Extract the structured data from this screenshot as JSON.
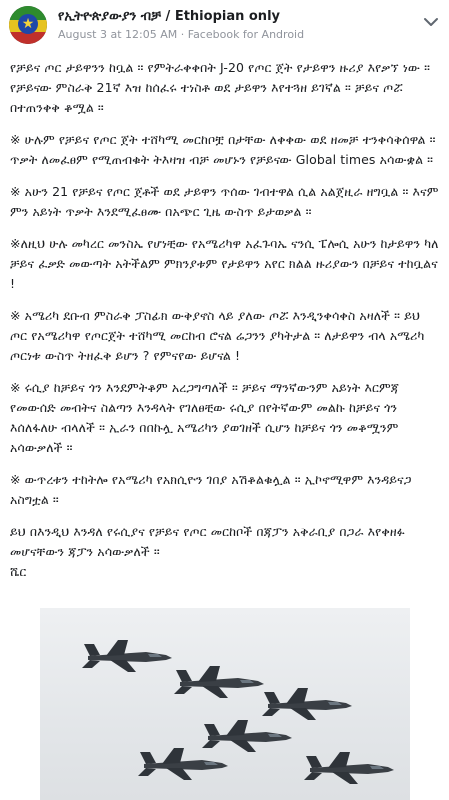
{
  "header": {
    "page_name": "የኢትዮጵያውያን ብቻ / Ethiopian only",
    "date": "August 3 at 12:05 AM",
    "separator": "·",
    "source": "Facebook for Android"
  },
  "post": {
    "paragraphs": [
      "የቻይና ጦር ታይዋንን ከቧል ። የምትራቀቀበት J-20 የጦር ጀት የታይዋን ዙሪያ እየቃኘ ነው ። የቻይናው ምስራቅ 21ኛ እዝ ከሰፈሩ ተነስቶ ወደ ታይዋን እየተጓዘ ይገኛል ። ቻይና ጦሯ በተጠንቀቅ ቆሟል ።",
      "※ ሁሉም የቻይና የጦር ጀት ተሸካሚ መርከቦቿ በታቸው ለቀቀው ወደ ዘመቻ ተንቀሳቅሰዋል ። ጥቃት ለመፈፀም የሚጠብቁት ትእዛዝ ብቻ መሆኑን የቻይናው Global times አሳውቋል ።",
      "※ አሁን 21 የቻይና የጦር ጀቶች ወደ ታይዋን ጥሰው ገብተዋል ሲል አልጀዚራ ዘግቧል ። እናም ምን አይነት ጥቃት እንደሚፈፀሙ በአጭር ጊዜ ውስጥ ይታወቃል ።",
      "※ለዚህ ሁሉ መካረር መንስኤ የሆነቺው የአሜሪካዋ አፈጉባኤ ናንሲ ፔሎሲ አሁን ከታይዋን ካለ ቻይና ፈቃድ መውጣት አትችልም ምክንያቱም የታይዋን አየር ክልል ዙሪያውን በቻይና ተከቧልና !",
      "※ አሜሪካ ደቡብ ምስራቅ ፓስፊክ ውቅያኖስ ላይ ያለው ጦሯ እንዲንቀሳቀስ አዛለች ። ይህ ጦር የአሜሪካዋ የጦርጀት ተሸካሚ መርከብ ሮናል ሬጋንን ያካትታል ። ለታይዋን ብላ አሜሪካ ጦርነቱ ውስጥ ትዘፈቅ ይሆን ? የምናየው ይሆናል !",
      "※ ሩሲያ ከቻይና ጎን እንደምትቆም አረጋግጣለች ። ቻይና ማንኛውንም አይነት እርምጃ የመውሰድ መብትና ስልጣን እንዳላት የገለፀቺው ሩሲያ በየትኛውም መልኩ ከቻይና ጎን እሰለፋለሁ ብላለች ። ኢራን በበኩሏ አሜሪካን ያወገዘች ሲሆን ከቻይና ጎን መቆሟንም አሳውቃለች ።",
      "※ ውጥረቱን ተከትሎ የአሜሪካ የአክሲዮን ገበያ አሽቆልቁሏል ። ኢኮኖሚዋም እንዳይናጋ አስግቷል ።",
      "ይህ በእንዲህ እንዳለ የሩሲያና የቻይና የጦር መርከቦች በጃፓን አቅራቢያ በጋራ እየቀዘፉ መሆናቸውን ጃፓን አሳውቃለች ።\nሼር"
    ]
  },
  "colors": {
    "text": "#1c1e21",
    "meta": "#90949c"
  },
  "icons": {
    "chevron": "chevron-down-icon",
    "avatar": "page-avatar"
  }
}
